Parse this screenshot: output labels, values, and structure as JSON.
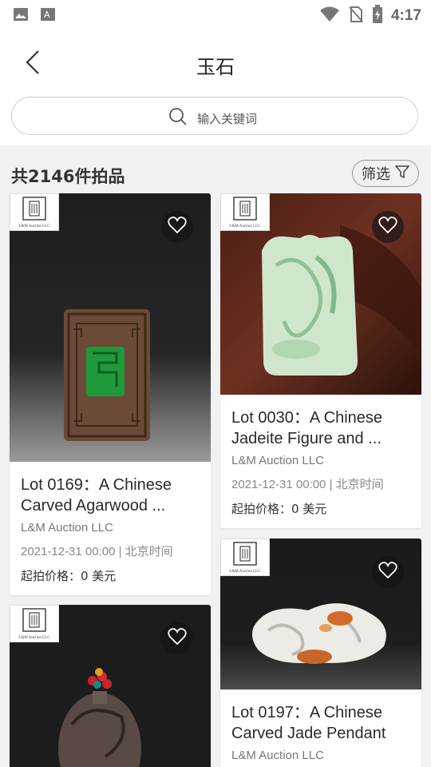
{
  "status_bar": {
    "time": "4:17"
  },
  "header": {
    "title": "玉石"
  },
  "search": {
    "placeholder": "输入关键词"
  },
  "results": {
    "count_text": "共2146件拍品",
    "filter_label": "筛选"
  },
  "brand": {
    "logo_text": "L&M Auction LLC"
  },
  "cards": [
    {
      "line1": "Lot 0169：A Chinese",
      "line2": "Carved Agarwood ...",
      "house": "L&M Auction LLC",
      "date": "2021-12-31 00:00 | 北京时间",
      "price": "起拍价格：0 美元"
    },
    {
      "line1": "Lot 0030：A Chinese",
      "line2": "Jadeite Figure and ...",
      "house": "L&M Auction LLC",
      "date": "2021-12-31 00:00 | 北京时间",
      "price": "起拍价格：0 美元"
    },
    {
      "line1": "Lot 0197：A Chinese",
      "line2": "Carved Jade Pendant",
      "house": "L&M Auction LLC"
    },
    {}
  ],
  "colors": {
    "page_bg": "#f1f1f1",
    "card_bg": "#ffffff",
    "jade_green": "#1f9a3a",
    "agarwood_brown": "#6b4a36"
  }
}
